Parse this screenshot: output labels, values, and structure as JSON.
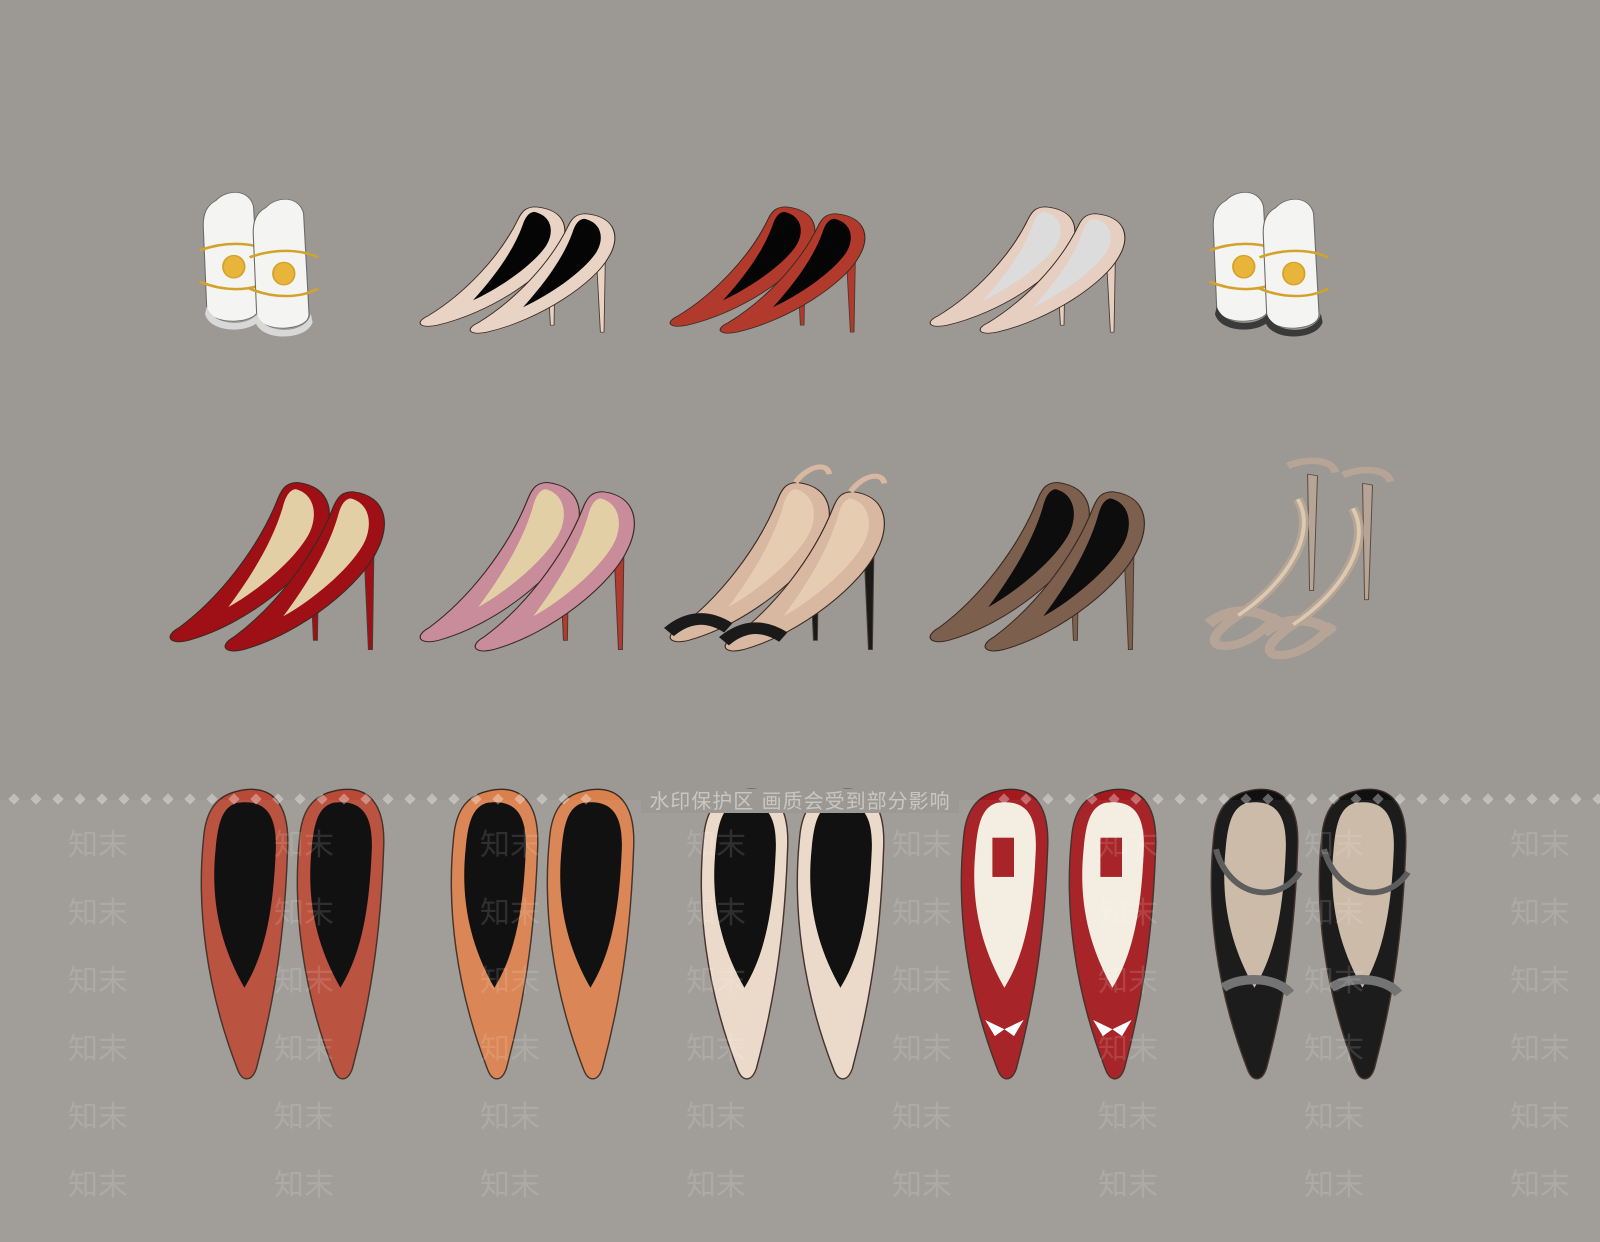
{
  "image": {
    "background_color": "#9c9893",
    "subject": "3D rendered women's shoes collection"
  },
  "rows": [
    {
      "style": "stiletto",
      "items": [
        {
          "style": "mule",
          "upper": "#f4f4f2",
          "lining": "#d8d8d8",
          "accent": "#d3a22a"
        },
        {
          "style": "pump",
          "upper": "#e9d3c4",
          "lining": "#050505",
          "accent": "#e9d3c4"
        },
        {
          "style": "pump",
          "upper": "#b13a2c",
          "lining": "#050505",
          "accent": "#b13a2c"
        },
        {
          "style": "pump",
          "upper": "#e6cfc0",
          "lining": "#dcdcdc",
          "accent": "#e6cfc0"
        },
        {
          "style": "mule",
          "upper": "#f4f4f2",
          "lining": "#3a3a3a",
          "accent": "#d3a22a"
        }
      ]
    },
    {
      "style": "pump",
      "items": [
        {
          "style": "pump",
          "upper": "#9e1015",
          "lining": "#e3cfa6",
          "accent": "#9e1015"
        },
        {
          "style": "pump",
          "upper": "#c98c9a",
          "lining": "#e3cfa6",
          "accent": "#b23a31"
        },
        {
          "style": "slingback",
          "upper": "#d8b8a0",
          "lining": "#e6cdb2",
          "accent": "#1a1a1a"
        },
        {
          "style": "pump",
          "upper": "#7d5f4e",
          "lining": "#0d0d0d",
          "accent": "#7d5f4e"
        },
        {
          "style": "sandal",
          "upper": "#b6a596",
          "lining": "#dccab0",
          "accent": "#b6a596"
        }
      ]
    },
    {
      "style": "flat",
      "items": [
        {
          "style": "flat",
          "upper": "#b84a37",
          "lining": "#050505",
          "accent": "#b84a37"
        },
        {
          "style": "flat",
          "upper": "#d9804d",
          "lining": "#050505",
          "accent": "#d9804d"
        },
        {
          "style": "flat",
          "upper": "#ead8c8",
          "lining": "#050505",
          "accent": "#ead8c8"
        },
        {
          "style": "bow-flat",
          "upper": "#a31a1e",
          "lining": "#f4ece0",
          "accent": "#ffffff"
        },
        {
          "style": "strap-flat",
          "upper": "#101010",
          "lining": "#c9b8a4",
          "accent": "#555555"
        }
      ]
    }
  ],
  "watermark": {
    "banner": "水印保护区  画质会受到部分影响",
    "tile": "知末",
    "tile_small": "知末"
  }
}
